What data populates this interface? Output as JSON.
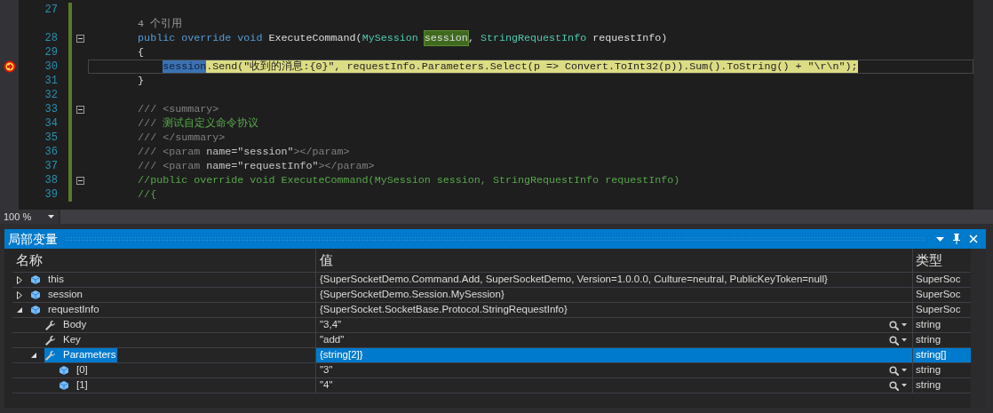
{
  "editor": {
    "lines": [
      {
        "kind": "code",
        "number": "27",
        "current": false,
        "fold": false
      },
      {
        "kind": "codelens",
        "text": "        4 个引用"
      },
      {
        "kind": "code",
        "number": "28",
        "current": false,
        "fold": true,
        "tokens": [
          {
            "text": "        public",
            "kind": "keyword"
          },
          {
            "text": " override",
            "kind": "keyword"
          },
          {
            "text": " void",
            "kind": "keyword"
          },
          {
            "text": " ExecuteCommand(",
            "kind": "plain"
          },
          {
            "text": "MySession ",
            "kind": "type"
          },
          {
            "text": "session",
            "kind": "reference"
          },
          {
            "text": ", ",
            "kind": "plain"
          },
          {
            "text": "StringRequestInfo",
            "kind": "type"
          },
          {
            "text": " requestInfo)",
            "kind": "plain"
          }
        ]
      },
      {
        "kind": "code",
        "number": "29",
        "current": false,
        "fold": false,
        "tokens": [
          {
            "text": "        {",
            "kind": "plain"
          }
        ]
      },
      {
        "kind": "code",
        "number": "30",
        "current": true,
        "fold": false,
        "tokens": [
          {
            "text": "            session",
            "kind": "selection"
          },
          {
            "text": ".Send(\"收到的消息:{0}\", requestInfo.Parameters.Select(p => Convert.ToInt32(p)).Sum().ToString() + \"\\r\\n\");",
            "kind": "plain"
          }
        ]
      },
      {
        "kind": "code",
        "number": "31",
        "current": false,
        "fold": false,
        "tokens": [
          {
            "text": "        }",
            "kind": "plain"
          }
        ]
      },
      {
        "kind": "code",
        "number": "32",
        "current": false,
        "fold": false
      },
      {
        "kind": "code",
        "number": "33",
        "current": false,
        "fold": true,
        "tokens": [
          {
            "text": "        /// <summary>",
            "kind": "doc-tag"
          }
        ]
      },
      {
        "kind": "code",
        "number": "34",
        "current": false,
        "fold": false,
        "tokens": [
          {
            "text": "        /// ",
            "kind": "doc-tag"
          },
          {
            "text": "测试自定义命令协议",
            "kind": "comment"
          }
        ]
      },
      {
        "kind": "code",
        "number": "35",
        "current": false,
        "fold": false,
        "tokens": [
          {
            "text": "        /// </summary>",
            "kind": "doc-tag"
          }
        ]
      },
      {
        "kind": "code",
        "number": "36",
        "current": false,
        "fold": false,
        "tokens": [
          {
            "text": "        /// <param ",
            "kind": "doc-tag"
          },
          {
            "text": "name=\"session\"",
            "kind": "doc-attr"
          },
          {
            "text": "></param>",
            "kind": "doc-tag"
          }
        ]
      },
      {
        "kind": "code",
        "number": "37",
        "current": false,
        "fold": false,
        "tokens": [
          {
            "text": "        /// <param ",
            "kind": "doc-tag"
          },
          {
            "text": "name=\"requestInfo\"",
            "kind": "doc-attr"
          },
          {
            "text": "></param>",
            "kind": "doc-tag"
          }
        ]
      },
      {
        "kind": "code",
        "number": "38",
        "current": false,
        "fold": true,
        "tokens": [
          {
            "text": "        //public override void ExecuteCommand(MySession session, StringRequestInfo requestInfo)",
            "kind": "comment"
          }
        ]
      },
      {
        "kind": "code",
        "number": "39",
        "current": false,
        "fold": false,
        "tokens": [
          {
            "text": "        //{",
            "kind": "comment"
          }
        ]
      }
    ],
    "zoom": "100 %"
  },
  "locals": {
    "title": "局部变量",
    "columns": [
      "名称",
      "值",
      "类型"
    ],
    "rows": [
      {
        "name": "this",
        "kind": "field",
        "value": "{SuperSocketDemo.Command.Add, SuperSocketDemo, Version=1.0.0.0, Culture=neutral, PublicKeyToken=null}",
        "type": "SuperSoc",
        "expanded": false,
        "selected": false,
        "visualizer": false
      },
      {
        "name": "session",
        "kind": "field",
        "value": "{SuperSocketDemo.Session.MySession}",
        "type": "SuperSoc",
        "expanded": false,
        "selected": false,
        "visualizer": false
      },
      {
        "name": "requestInfo",
        "kind": "field",
        "value": "{SuperSocket.SocketBase.Protocol.StringRequestInfo}",
        "type": "SuperSoc",
        "expanded": true,
        "selected": false,
        "visualizer": false,
        "children": [
          {
            "name": "Body",
            "kind": "property",
            "value": "\"3,4\"",
            "type": "string",
            "selected": false,
            "visualizer": true
          },
          {
            "name": "Key",
            "kind": "property",
            "value": "\"add\"",
            "type": "string",
            "selected": false,
            "visualizer": true
          },
          {
            "name": "Parameters",
            "kind": "property",
            "value": "{string[2]}",
            "type": "string[]",
            "expanded": true,
            "selected": true,
            "visualizer": false,
            "children": [
              {
                "name": "[0]",
                "kind": "field",
                "value": "\"3\"",
                "type": "string",
                "selected": false,
                "visualizer": true
              },
              {
                "name": "[1]",
                "kind": "field",
                "value": "\"4\"",
                "type": "string",
                "selected": false,
                "visualizer": true
              }
            ]
          }
        ]
      }
    ]
  }
}
